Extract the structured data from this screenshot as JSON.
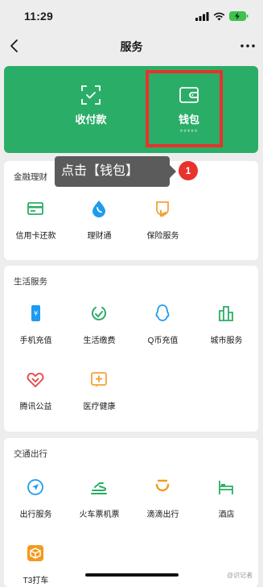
{
  "status_bar": {
    "time": "11:29"
  },
  "nav": {
    "title": "服务"
  },
  "top_card": {
    "items": [
      {
        "label": "收付款",
        "sub": ""
      },
      {
        "label": "钱包",
        "sub": "*****"
      }
    ]
  },
  "annotation": {
    "tooltip": "点击【钱包】",
    "step": "1"
  },
  "sections": [
    {
      "title": "金融理财",
      "items": [
        {
          "label": "信用卡还款",
          "icon": "credit-card-icon"
        },
        {
          "label": "理财通",
          "icon": "wealth-drop-icon"
        },
        {
          "label": "保险服务",
          "icon": "insurance-hand-icon"
        }
      ]
    },
    {
      "title": "生活服务",
      "items": [
        {
          "label": "手机充值",
          "icon": "phone-topup-icon"
        },
        {
          "label": "生活缴费",
          "icon": "bill-pay-icon"
        },
        {
          "label": "Q币充值",
          "icon": "qq-penguin-icon"
        },
        {
          "label": "城市服务",
          "icon": "city-buildings-icon"
        },
        {
          "label": "腾讯公益",
          "icon": "charity-heart-icon"
        },
        {
          "label": "医疗健康",
          "icon": "medical-cross-icon"
        }
      ]
    },
    {
      "title": "交通出行",
      "items": [
        {
          "label": "出行服务",
          "icon": "navigation-arrow-icon"
        },
        {
          "label": "火车票机票",
          "icon": "train-plane-icon"
        },
        {
          "label": "滴滴出行",
          "icon": "didi-icon"
        },
        {
          "label": "酒店",
          "icon": "hotel-bed-icon"
        },
        {
          "label": "T3打车",
          "icon": "t3-cube-icon"
        }
      ]
    }
  ],
  "watermark": "@识记者",
  "colors": {
    "brand_green": "#2aad67",
    "highlight_red": "#e8322c",
    "background": "#ededed"
  }
}
